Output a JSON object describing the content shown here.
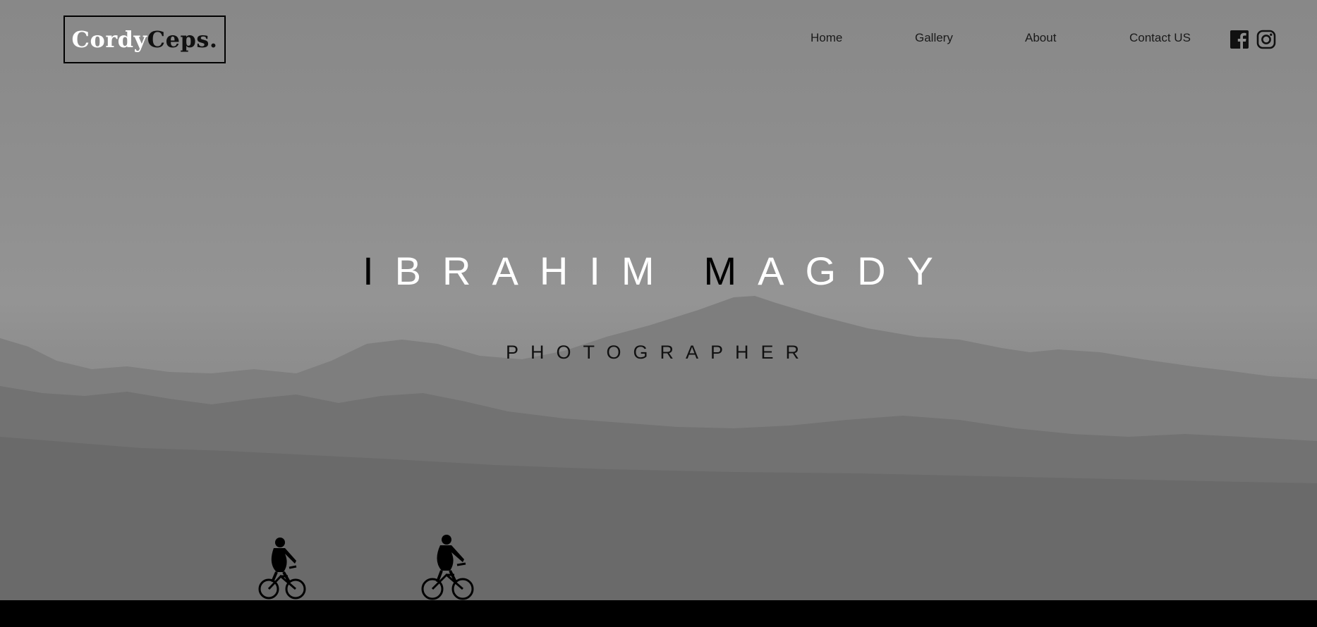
{
  "brand": {
    "logo_part_1": "Cordy",
    "logo_part_2": "Ceps."
  },
  "nav": {
    "items": [
      {
        "label": "Home"
      },
      {
        "label": "Gallery"
      },
      {
        "label": "About"
      },
      {
        "label": "Contact US"
      }
    ]
  },
  "social": {
    "icons": [
      "facebook-icon",
      "instagram-icon"
    ]
  },
  "hero": {
    "name_first": "IBRAHIM",
    "name_last": "MAGDY",
    "title": "PHOTOGRAPHER",
    "name_colors": [
      "#000000",
      "#ffffff",
      "#ffffff",
      "#ffffff",
      "#ffffff",
      "#ffffff",
      "#ffffff",
      "#000000",
      "#ffffff",
      "#ffffff",
      "#ffffff",
      "#ffffff"
    ]
  },
  "colors": {
    "sky": "#8e8e8e",
    "mountains_far": "#7e7e7e",
    "mountains_near": "#6a6a6a",
    "ground": "#000000",
    "text_dark": "#111111",
    "text_light": "#ffffff"
  }
}
